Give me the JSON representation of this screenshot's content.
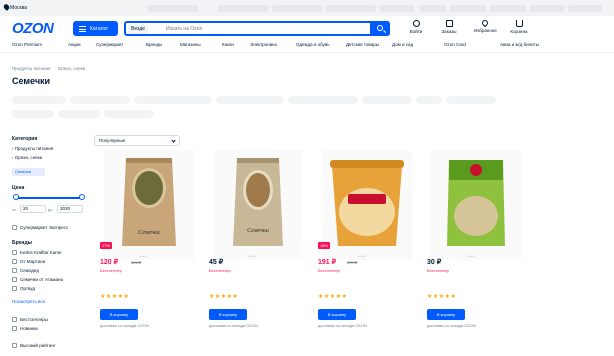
{
  "header": {
    "city": "Москва",
    "top_links": [
      "",
      "",
      "",
      "",
      "",
      "",
      "",
      "",
      "",
      "",
      "",
      ""
    ],
    "logo": "OZON",
    "catalog_label": "Каталог",
    "search_scope": "Везде",
    "search_placeholder": "Искать на Ozon",
    "actions": [
      "Войти",
      "Заказы",
      "Избранное",
      "Корзина"
    ],
    "nav": [
      "Ozon Premium",
      "Акции",
      "Супермаркет",
      "Бренды",
      "Магазины",
      "Книги",
      "Электроника",
      "Одежда и обувь",
      "Детские товары",
      "Дом и сад",
      "",
      "Ozon Card",
      "Авиа и ж/д билеты"
    ]
  },
  "breadcrumbs": [
    "Продукты питания",
    "Орехи, снеки"
  ],
  "page": {
    "title": "Семечки",
    "count": ""
  },
  "chips": [
    "",
    "",
    "",
    "",
    "",
    "",
    "",
    "",
    "",
    "",
    "",
    ""
  ],
  "sidebar": {
    "category_title": "Категория",
    "categories": [
      "Продукты питания",
      "Орехи, снеки",
      "Семечки"
    ],
    "price_title": "Цена",
    "price_from_label": "от",
    "price_from": "20",
    "price_to_label": "до",
    "price_to": "3030",
    "express": "Супермаркет Экспресс",
    "brands_title": "Бренды",
    "brands": [
      "Kerbis Kraftlar Kame",
      "От Мартина",
      "Семодед",
      "Семечки от Атамана",
      "Ортвуд"
    ],
    "show_all": "Посмотреть все",
    "flags": [
      "Бестселлеры",
      "Новинки"
    ],
    "high_rating": "Высокий рейтинг"
  },
  "sort": {
    "selected": "Популярные"
  },
  "products": [
    {
      "discount": "17%",
      "price": "120 ₽",
      "old_price": "145 ₽",
      "brand": "Бестселлер",
      "name": "",
      "reviews": "",
      "cart": "В корзину",
      "delivery": "доставка со склада OZON",
      "pack_label": "Семечки",
      "pack_color": "#c9a679"
    },
    {
      "discount": "",
      "price": "45 ₽",
      "old_price": "",
      "brand": "Бестселлер",
      "name": "",
      "reviews": "",
      "cart": "В корзину",
      "delivery": "доставка со склада OZON",
      "pack_label": "Семечки",
      "pack_color": "#c8b898"
    },
    {
      "discount": "18%",
      "price": "191 ₽",
      "old_price": "233 ₽",
      "brand": "Бестселлер",
      "name": "",
      "reviews": "",
      "cart": "В корзину",
      "delivery": "доставка со склада OZON",
      "pack_label": "",
      "pack_color": "#e8a23a"
    },
    {
      "discount": "",
      "price": "30 ₽",
      "old_price": "",
      "brand": "Бестселлер",
      "name": "",
      "reviews": "",
      "cart": "В корзину",
      "delivery": "доставка со склада OZON",
      "pack_label": "",
      "pack_color": "#8ec13d"
    }
  ],
  "colors": {
    "accent": "#005bff",
    "sale": "#f91155",
    "star": "#ffa800"
  }
}
